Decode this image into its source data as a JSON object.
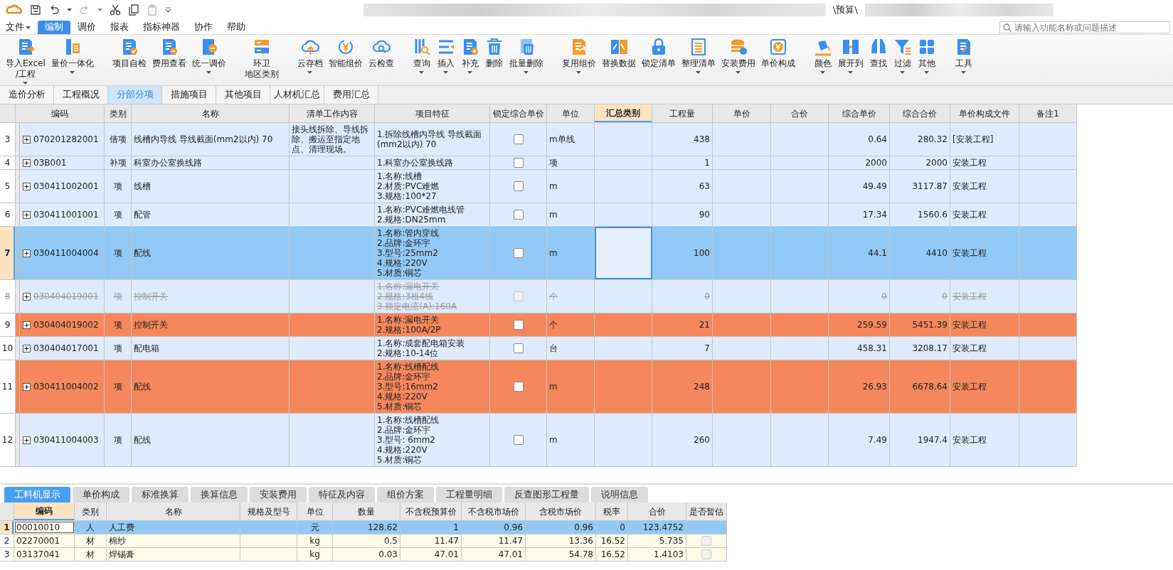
{
  "window": {
    "title": "\\预算\\"
  },
  "menu": [
    {
      "label": "文件",
      "selected": false,
      "dropdown": true
    },
    {
      "label": "编制",
      "selected": true,
      "dropdown": false
    },
    {
      "label": "调价",
      "selected": false,
      "dropdown": false
    },
    {
      "label": "报表",
      "selected": false,
      "dropdown": false
    },
    {
      "label": "指标神器",
      "selected": false,
      "dropdown": false
    },
    {
      "label": "协作",
      "selected": false,
      "dropdown": false
    },
    {
      "label": "帮助",
      "selected": false,
      "dropdown": false
    }
  ],
  "search": {
    "placeholder": "请输入功能名称或问题描述"
  },
  "ribbon": {
    "groups": [
      [
        {
          "lines": [
            "导入Excel",
            "/工程"
          ],
          "dropdown": true
        },
        {
          "label": "量价一体化",
          "dropdown": true
        }
      ],
      [
        {
          "label": "项目自检",
          "dropdown": false
        },
        {
          "label": "费用查看",
          "dropdown": false
        },
        {
          "label": "统一调价",
          "dropdown": true
        }
      ],
      [
        {
          "lines": [
            "环卫",
            "地区类别"
          ],
          "dropdown": false
        }
      ],
      [
        {
          "label": "云存档",
          "dropdown": true
        },
        {
          "label": "智能组价",
          "dropdown": false
        },
        {
          "label": "云检查",
          "dropdown": false
        }
      ],
      [
        {
          "label": "查询",
          "dropdown": true
        },
        {
          "label": "插入",
          "dropdown": true
        },
        {
          "label": "补充",
          "dropdown": true
        },
        {
          "label": "删除",
          "dropdown": false
        },
        {
          "label": "批量删除",
          "dropdown": true
        }
      ],
      [
        {
          "label": "复用组价",
          "dropdown": true
        },
        {
          "label": "替换数据",
          "dropdown": false
        },
        {
          "label": "锁定清单",
          "dropdown": false
        },
        {
          "label": "整理清单",
          "dropdown": true
        },
        {
          "label": "安装费用",
          "dropdown": true
        },
        {
          "label": "单价构成",
          "dropdown": false
        }
      ],
      [
        {
          "label": "颜色",
          "dropdown": true
        },
        {
          "label": "展开到",
          "dropdown": true
        },
        {
          "label": "查找",
          "dropdown": false
        },
        {
          "label": "过滤",
          "dropdown": true
        },
        {
          "label": "其他",
          "dropdown": true
        }
      ],
      [
        {
          "label": "工具",
          "dropdown": true
        }
      ]
    ]
  },
  "tabs": [
    {
      "label": "造价分析",
      "selected": false
    },
    {
      "label": "工程概况",
      "selected": false
    },
    {
      "label": "分部分项",
      "selected": true
    },
    {
      "label": "措施项目",
      "selected": false
    },
    {
      "label": "其他项目",
      "selected": false
    },
    {
      "label": "人材机汇总",
      "selected": false
    },
    {
      "label": "费用汇总",
      "selected": false
    }
  ],
  "table": {
    "columns": [
      {
        "selected": false
      },
      {
        "label": "编码",
        "selected": false
      },
      {
        "label": "类别",
        "selected": false
      },
      {
        "label": "名称",
        "selected": false
      },
      {
        "label": "清单工作内容",
        "selected": false
      },
      {
        "label": "项目特征",
        "selected": false
      },
      {
        "label": "锁定综合单价",
        "selected": false
      },
      {
        "label": "单位",
        "selected": false
      },
      {
        "label": "汇总类别",
        "selected": true
      },
      {
        "label": "工程量",
        "selected": false
      },
      {
        "label": "单价",
        "selected": false
      },
      {
        "label": "合价",
        "selected": false
      },
      {
        "label": "综合单价",
        "selected": false
      },
      {
        "label": "综合合价",
        "selected": false
      },
      {
        "label": "单价构成文件",
        "selected": false
      },
      {
        "label": "备注1",
        "selected": false
      }
    ],
    "rows": [
      {
        "row_number": "3",
        "code": "070201282001",
        "category": "借项",
        "name": "线槽内导线 导线截面(mm2以内) 70",
        "work_content": "接头线拆除、导线拆除、搬运至指定地点、清理现场。",
        "features": "1.拆除线槽内导线 导线截面(mm2以内) 70",
        "locked": false,
        "unit": "m单线",
        "quantity": "438",
        "composite_unit_price": "0.64",
        "composite_total": "280.32",
        "price_file": "[安装工程]",
        "selected": false,
        "highlighted": false,
        "deleted": false
      },
      {
        "row_number": "4",
        "code": "03B001",
        "category": "补项",
        "name": "科室办公室换线路",
        "features": "1.科室办公室换线路",
        "locked": false,
        "unit": "项",
        "quantity": "1",
        "composite_unit_price": "2000",
        "composite_total": "2000",
        "price_file": "安装工程",
        "selected": false,
        "highlighted": false,
        "deleted": false
      },
      {
        "row_number": "5",
        "code": "030411002001",
        "category": "项",
        "name": "线槽",
        "features": "1.名称:线槽\n2.材质:PVC难燃\n3.规格:100*27",
        "locked": false,
        "unit": "m",
        "quantity": "63",
        "composite_unit_price": "49.49",
        "composite_total": "3117.87",
        "price_file": "安装工程",
        "selected": false,
        "highlighted": false,
        "deleted": false
      },
      {
        "row_number": "6",
        "code": "030411001001",
        "category": "项",
        "name": "配管",
        "features": "1.名称:PVC难燃电线管\n2.规格:DN25mm",
        "locked": false,
        "unit": "m",
        "quantity": "90",
        "composite_unit_price": "17.34",
        "composite_total": "1560.6",
        "price_file": "安装工程",
        "selected": false,
        "highlighted": false,
        "deleted": false
      },
      {
        "row_number": "7",
        "code": "030411004004",
        "category": "项",
        "name": "配线",
        "features": "1.名称:管内穿线\n2.品牌:金环宇\n3.型号:25mm2\n4.规格:220V\n5.材质:铜芯",
        "locked": false,
        "unit": "m",
        "quantity": "100",
        "composite_unit_price": "44.1",
        "composite_total": "4410",
        "price_file": "安装工程",
        "selected": true,
        "highlighted": false,
        "deleted": false
      },
      {
        "row_number": "8",
        "code": "030404019001",
        "category": "项",
        "name": "控制开关",
        "features": "1.名称:漏电开关\n2.规格:3相4线\n3.额定电流(A):160A",
        "locked": false,
        "unit": "个",
        "quantity": "0",
        "composite_unit_price": "0",
        "composite_total": "0",
        "price_file": "安装工程",
        "selected": false,
        "highlighted": false,
        "deleted": true
      },
      {
        "row_number": "9",
        "code": "030404019002",
        "category": "项",
        "name": "控制开关",
        "features": "1.名称:漏电开关\n2.规格:100A/2P",
        "locked": false,
        "unit": "个",
        "quantity": "21",
        "composite_unit_price": "259.59",
        "composite_total": "5451.39",
        "price_file": "安装工程",
        "selected": false,
        "highlighted": true,
        "deleted": false
      },
      {
        "row_number": "10",
        "code": "030404017001",
        "category": "项",
        "name": "配电箱",
        "features": "1.名称:成套配电箱安装\n2.规格:10-14位",
        "locked": false,
        "unit": "台",
        "quantity": "7",
        "composite_unit_price": "458.31",
        "composite_total": "3208.17",
        "price_file": "安装工程",
        "selected": false,
        "highlighted": false,
        "deleted": false
      },
      {
        "row_number": "11",
        "code": "030411004002",
        "category": "项",
        "name": "配线",
        "features": "1.名称:线槽配线\n2.品牌:金环宇\n3.型号:16mm2\n4.规格:220V\n5.材质:铜芯",
        "locked": false,
        "unit": "m",
        "quantity": "248",
        "composite_unit_price": "26.93",
        "composite_total": "6678.64",
        "price_file": "安装工程",
        "selected": false,
        "highlighted": true,
        "deleted": false
      },
      {
        "row_number": "12",
        "code": "030411004003",
        "category": "项",
        "name": "配线",
        "features": "1.名称:线槽配线\n2.品牌:金环宇\n3.型号: 6mm2\n4.规格:220V\n5.材质:铜芯",
        "locked": false,
        "unit": "m",
        "quantity": "260",
        "composite_unit_price": "7.49",
        "composite_total": "1947.4",
        "price_file": "安装工程",
        "selected": false,
        "highlighted": false,
        "deleted": false
      }
    ]
  },
  "detail_tabs": [
    {
      "label": "工料机显示",
      "selected": true
    },
    {
      "label": "单价构成",
      "selected": false
    },
    {
      "label": "标准换算",
      "selected": false
    },
    {
      "label": "换算信息",
      "selected": false
    },
    {
      "label": "安装费用",
      "selected": false
    },
    {
      "label": "特征及内容",
      "selected": false
    },
    {
      "label": "组价方案",
      "selected": false
    },
    {
      "label": "工程量明细",
      "selected": false
    },
    {
      "label": "反查图形工程量",
      "selected": false
    },
    {
      "label": "说明信息",
      "selected": false
    }
  ],
  "detail_table": {
    "columns": [
      {
        "selected": false
      },
      {
        "label": "编码",
        "selected": true
      },
      {
        "label": "类别",
        "selected": false
      },
      {
        "label": "名称",
        "selected": false
      },
      {
        "label": "规格及型号",
        "selected": false
      },
      {
        "label": "单位",
        "selected": false
      },
      {
        "label": "数量",
        "selected": false
      },
      {
        "label": "不含税预算价",
        "selected": false
      },
      {
        "label": "不含税市场价",
        "selected": false
      },
      {
        "label": "含税市场价",
        "selected": false
      },
      {
        "label": "税率",
        "selected": false
      },
      {
        "label": "合价",
        "selected": false
      },
      {
        "label": "是否暂估",
        "selected": false
      }
    ],
    "rows": [
      {
        "row_number": "1",
        "code": "00010010",
        "category": "人",
        "name": "人工费",
        "unit": "元",
        "quantity": "128.62",
        "pretax_budget_price": "1",
        "pretax_market_price": "0.96",
        "market_price_with_tax": "0.96",
        "tax_rate": "0",
        "total": "123.4752",
        "selected": true
      },
      {
        "row_number": "2",
        "code": "02270001",
        "category": "材",
        "name": "棉纱",
        "unit": "kg",
        "quantity": "0.5",
        "pretax_budget_price": "11.47",
        "pretax_market_price": "11.47",
        "market_price_with_tax": "13.36",
        "tax_rate": "16.52",
        "total": "5.735",
        "estimated": false,
        "selected": false
      },
      {
        "row_number": "3",
        "code": "03137041",
        "category": "材",
        "name": "焊锡膏",
        "unit": "kg",
        "quantity": "0.03",
        "pretax_budget_price": "47.01",
        "pretax_market_price": "47.01",
        "market_price_with_tax": "54.78",
        "tax_rate": "16.52",
        "total": "1.4103",
        "estimated": false,
        "selected": false
      }
    ]
  }
}
